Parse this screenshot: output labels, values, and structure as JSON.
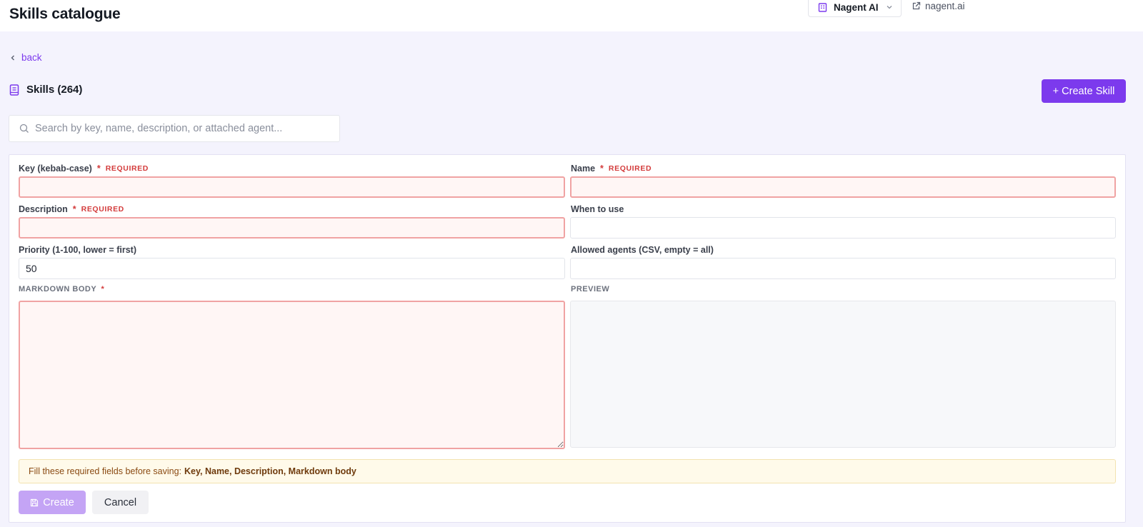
{
  "header": {
    "title": "Skills catalogue",
    "org_name": "Nagent AI",
    "external_link": "nagent.ai"
  },
  "nav": {
    "back_label": "back"
  },
  "section": {
    "title": "Skills (264)",
    "create_button": "+ Create Skill"
  },
  "search": {
    "placeholder": "Search by key, name, description, or attached agent..."
  },
  "form": {
    "key": {
      "label": "Key (kebab-case)",
      "required_mark": "*",
      "required_text": "REQUIRED",
      "value": ""
    },
    "name": {
      "label": "Name",
      "required_mark": "*",
      "required_text": "REQUIRED",
      "value": ""
    },
    "description": {
      "label": "Description",
      "required_mark": "*",
      "required_text": "REQUIRED",
      "value": ""
    },
    "when_to_use": {
      "label": "When to use",
      "value": ""
    },
    "priority": {
      "label": "Priority (1-100, lower = first)",
      "value": "50"
    },
    "allowed_agents": {
      "label": "Allowed agents (CSV, empty = all)",
      "value": ""
    },
    "markdown_body": {
      "label": "MARKDOWN BODY",
      "required_mark": "*",
      "value": ""
    },
    "preview": {
      "label": "PREVIEW"
    },
    "warning": {
      "prefix": "Fill these required fields before saving:",
      "fields": "Key, Name, Description, Markdown body"
    },
    "create_button": "Create",
    "cancel_button": "Cancel"
  },
  "colors": {
    "accent": "#7c3aed",
    "accent_disabled": "#c4a4f5",
    "required": "#d33b3b",
    "invalid_border": "#f0a3a3",
    "invalid_bg": "#fff6f5",
    "warning_bg": "#fffaea",
    "page_bg": "#f4f3fd"
  },
  "icons": {
    "org": "building-icon",
    "dropdown": "chevron-down-icon",
    "external": "external-link-icon",
    "back": "chevron-left-icon",
    "section": "book-icon",
    "search": "search-icon",
    "save": "save-icon"
  }
}
